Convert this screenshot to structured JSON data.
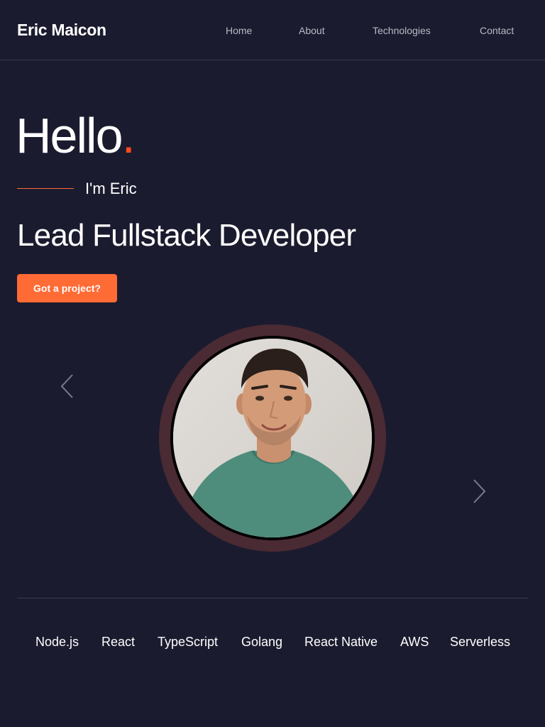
{
  "header": {
    "brand": "Eric Maicon",
    "nav": [
      "Home",
      "About",
      "Technologies",
      "Contact"
    ]
  },
  "hero": {
    "greeting": "Hello",
    "greeting_dot": ".",
    "intro": "I'm Eric",
    "role": "Lead Fullstack Developer",
    "cta_label": "Got a project?"
  },
  "carousel": {
    "prev_icon": "chevron-left-icon",
    "next_icon": "chevron-right-icon",
    "ring_color": "#4a2a33"
  },
  "technologies": [
    "Node.js",
    "React",
    "TypeScript",
    "Golang",
    "React Native",
    "AWS",
    "Serverless"
  ],
  "colors": {
    "background": "#1b1b2f",
    "accent": "#ff6b35",
    "accent_dot": "#ff4a1c",
    "nav_text": "#b9b9c6"
  }
}
